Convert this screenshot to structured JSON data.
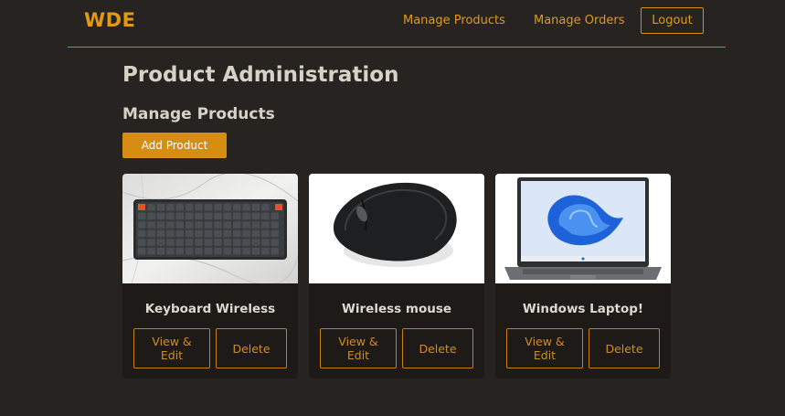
{
  "header": {
    "brand": "WDE",
    "nav": [
      "Manage Products",
      "Manage Orders"
    ],
    "logout_label": "Logout"
  },
  "main": {
    "title": "Product Administration",
    "section_title": "Manage Products",
    "add_button_label": "Add Product"
  },
  "products": [
    {
      "name": "Keyboard Wireless",
      "image": "keyboard-image",
      "edit_label": "View &\nEdit",
      "delete_label": "Delete"
    },
    {
      "name": "Wireless mouse",
      "image": "mouse-image",
      "edit_label": "View &\nEdit",
      "delete_label": "Delete"
    },
    {
      "name": "Windows Laptop!",
      "image": "laptop-image",
      "edit_label": "View &\nEdit",
      "delete_label": "Delete"
    }
  ],
  "colors": {
    "accent": "#e19a16",
    "background": "#262320",
    "card": "#1d1a18",
    "button": "#d58d12"
  }
}
